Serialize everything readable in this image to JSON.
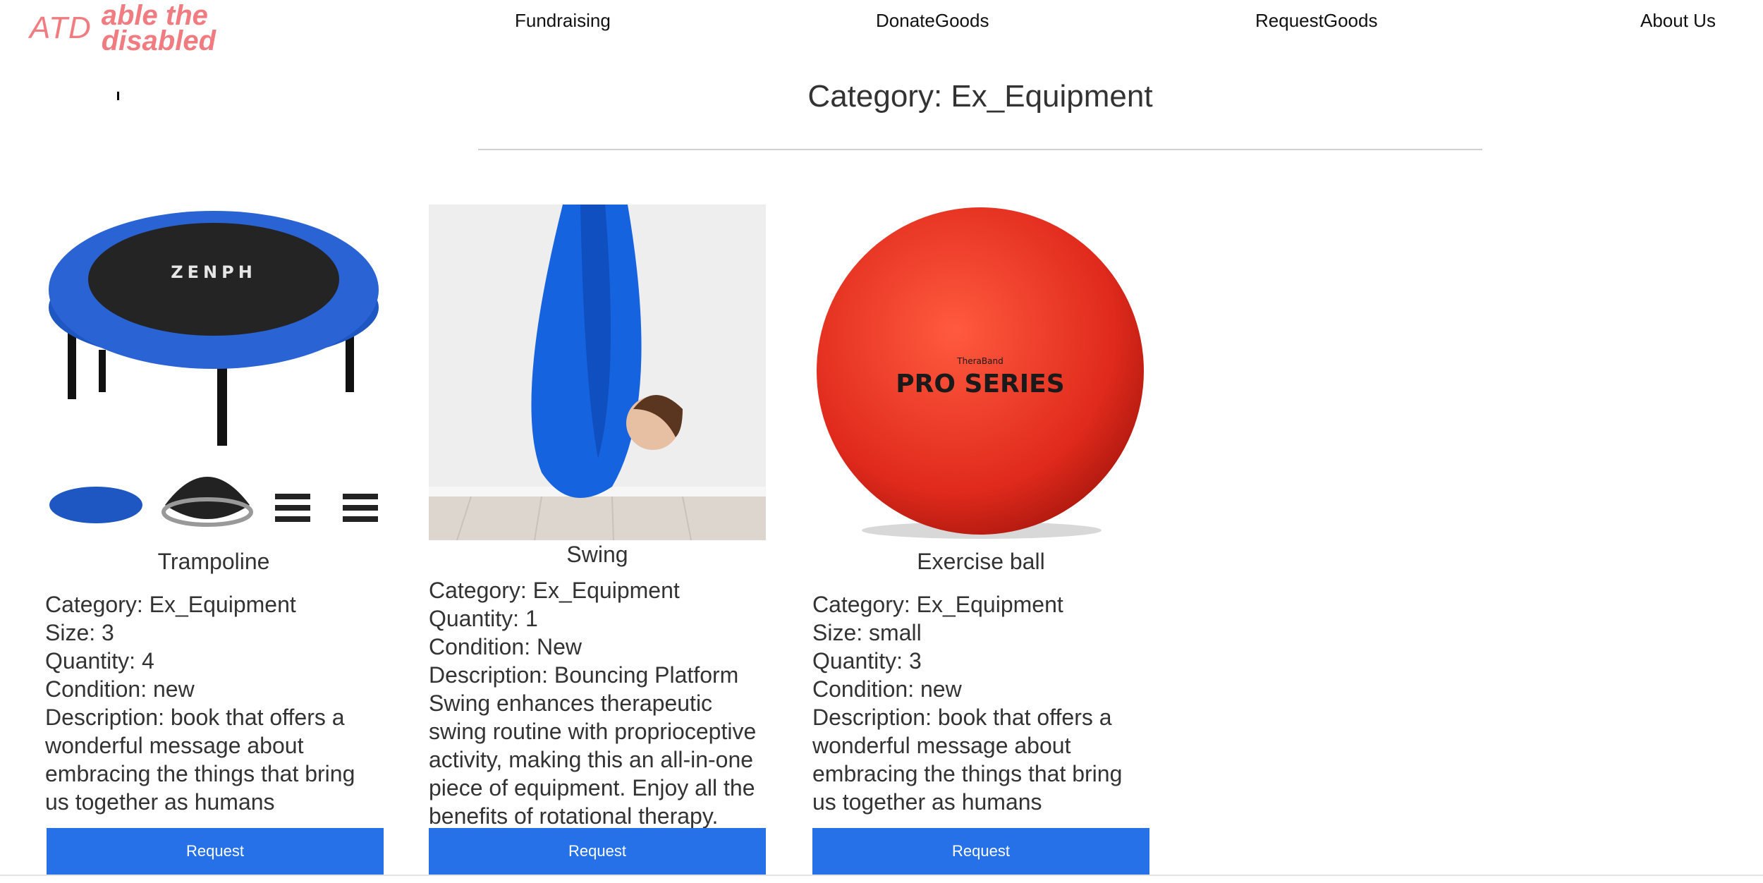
{
  "header": {
    "logo_short": "ATD",
    "logo_line1": "able the",
    "logo_line2": "disabled",
    "nav": [
      "Fundraising",
      "DonateGoods",
      "RequestGoods",
      "About Us"
    ]
  },
  "page_title": "Category: Ex_Equipment",
  "colors": {
    "brand": "#f07b80",
    "button": "#2670e8"
  },
  "cards": [
    {
      "name": "Trampoline",
      "image_icon": "trampoline-image",
      "details": [
        "Category: Ex_Equipment",
        "Size: 3",
        "Quantity: 4",
        "Condition: new",
        "Description: book that offers a wonderful message about embracing the things that bring us together as humans"
      ],
      "button": "Request"
    },
    {
      "name": "Swing",
      "image_icon": "swing-image",
      "details": [
        "Category: Ex_Equipment",
        "Quantity: 1",
        "Condition: New",
        "Description: Bouncing Platform Swing enhances therapeutic swing routine with proprioceptive activity, making this an all-in-one piece of equipment. Enjoy all the benefits of rotational therapy."
      ],
      "button": "Request"
    },
    {
      "name": "Exercise ball",
      "image_icon": "exercise-ball-image",
      "image_brand_small": "TheraBand",
      "image_brand": "PRO SERIES",
      "details": [
        "Category: Ex_Equipment",
        "Size: small",
        "Quantity: 3",
        "Condition: new",
        "Description: book that offers a wonderful message about embracing the things that bring us together as humans"
      ],
      "button": "Request"
    }
  ]
}
